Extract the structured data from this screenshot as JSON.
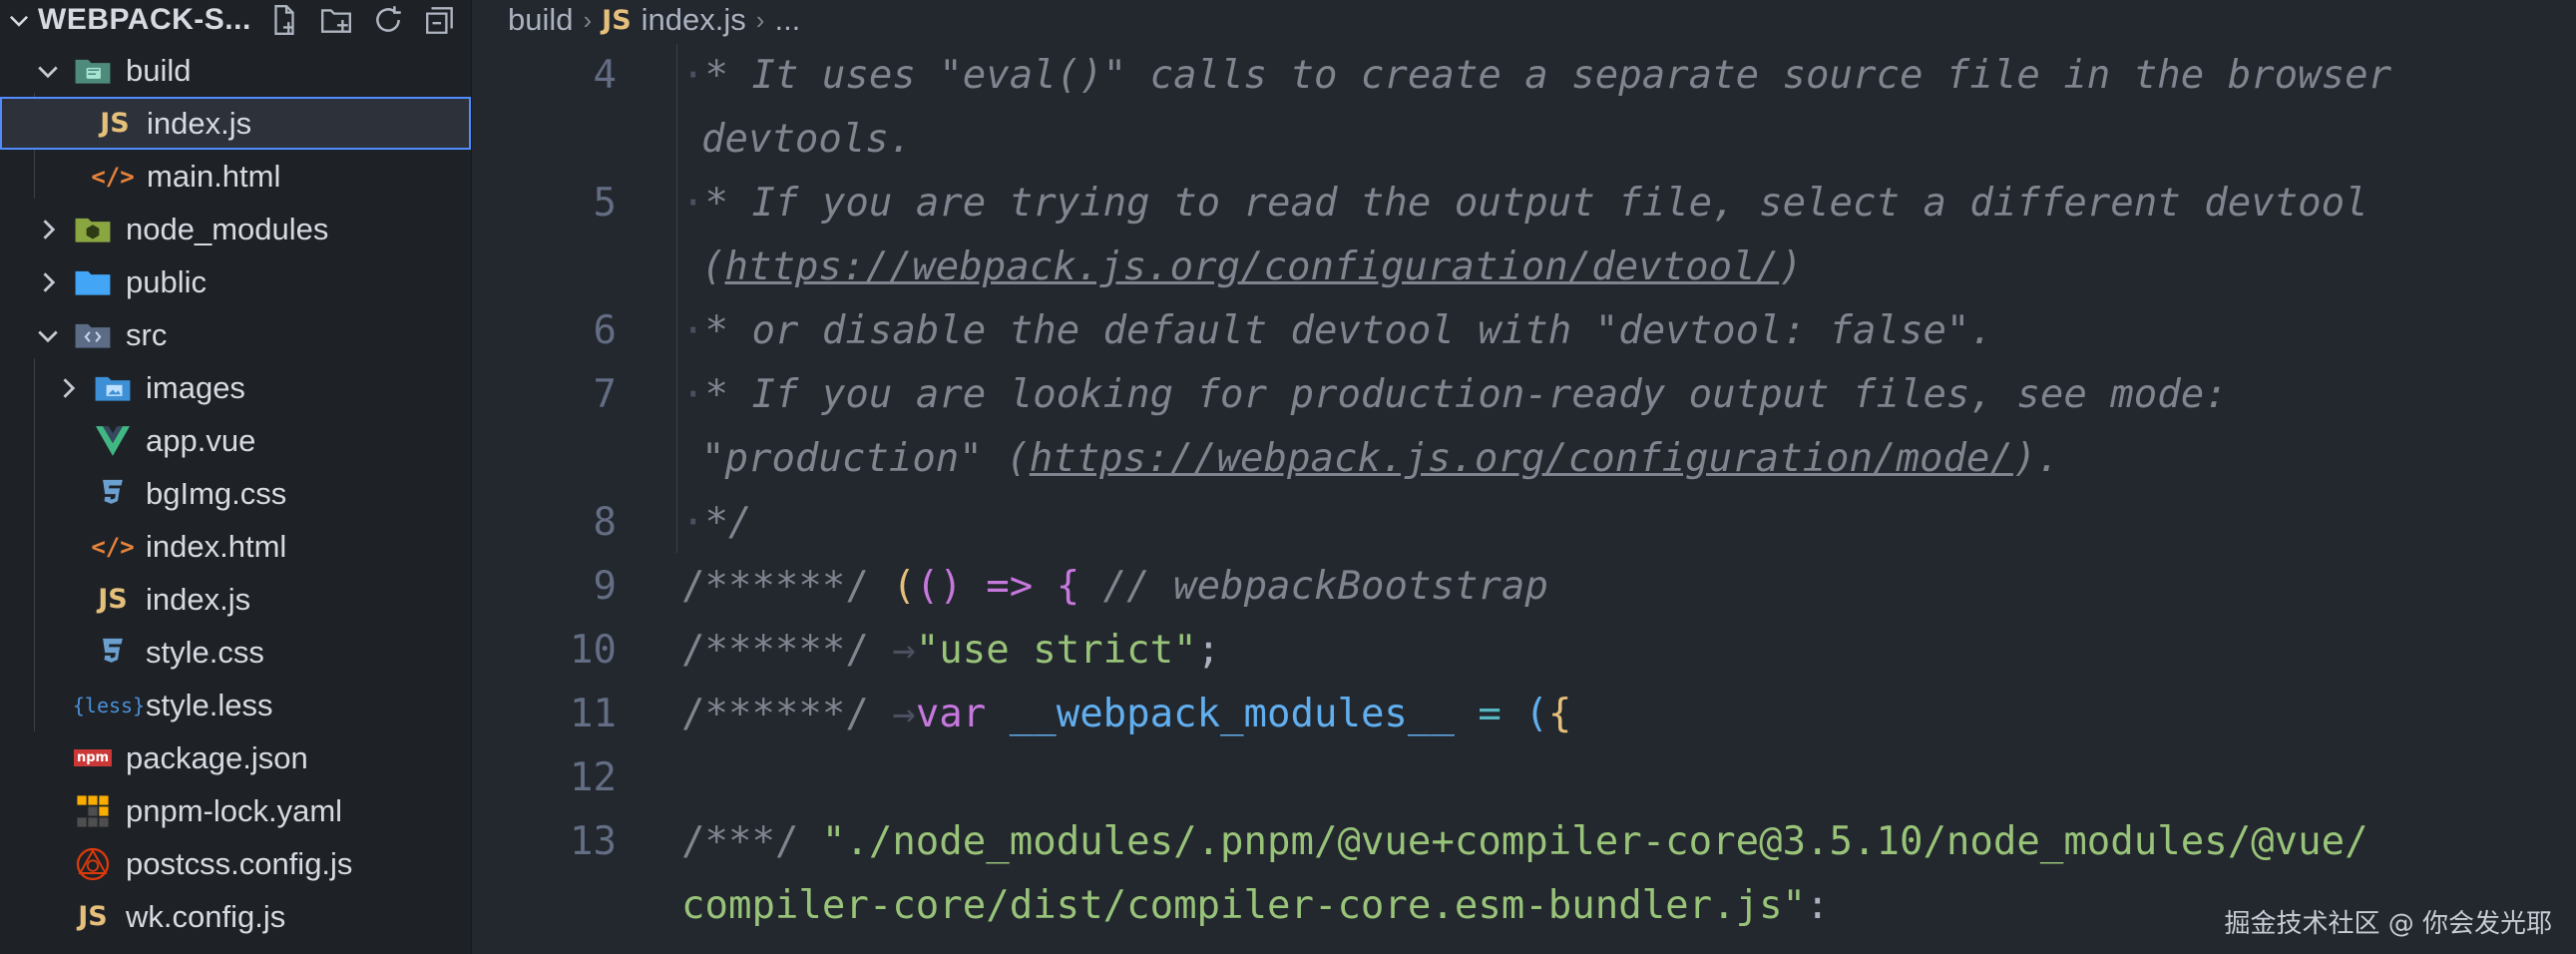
{
  "explorer": {
    "title": "WEBPACK-S...",
    "items": [
      {
        "label": "build",
        "kind": "folder-open"
      },
      {
        "label": "index.js",
        "kind": "js"
      },
      {
        "label": "main.html",
        "kind": "html"
      },
      {
        "label": "node_modules",
        "kind": "folder"
      },
      {
        "label": "public",
        "kind": "folder"
      },
      {
        "label": "src",
        "kind": "folder-open"
      },
      {
        "label": "images",
        "kind": "folder"
      },
      {
        "label": "app.vue",
        "kind": "vue"
      },
      {
        "label": "bgImg.css",
        "kind": "css"
      },
      {
        "label": "index.html",
        "kind": "html"
      },
      {
        "label": "index.js",
        "kind": "js"
      },
      {
        "label": "style.css",
        "kind": "css"
      },
      {
        "label": "style.less",
        "kind": "less"
      },
      {
        "label": "package.json",
        "kind": "npm"
      },
      {
        "label": "pnpm-lock.yaml",
        "kind": "pnpm"
      },
      {
        "label": "postcss.config.js",
        "kind": "postcss"
      },
      {
        "label": "wk.config.js",
        "kind": "js"
      }
    ],
    "icon_text": {
      "js": "JS",
      "html": "</>",
      "less": "{less}",
      "npm": "npm"
    }
  },
  "breadcrumb": {
    "folder": "build",
    "file_icon": "JS",
    "file": "index.js",
    "more": "..."
  },
  "code": {
    "line_numbers": [
      "4",
      "5",
      "6",
      "7",
      "8",
      "9",
      "10",
      "11",
      "12",
      "13"
    ],
    "l4a": "It uses \"eval()\" calls to create a separate source file in the browser",
    "l4b": "devtools.",
    "l5a": "If you are trying to read the output file, select a different devtool",
    "l5b_open": "(",
    "l5b_url": "https://webpack.js.org/configuration/devtool/",
    "l5b_close": ")",
    "l6": "or disable the default devtool with \"devtool: false\".",
    "l7a": "If you are looking for production-ready output files, see mode:",
    "l7b_pre": "\"production\" (",
    "l7b_url": "https://webpack.js.org/configuration/mode/",
    "l7b_post": ").",
    "l8": "*/",
    "l9_comment": "/******/",
    "l9_comment2": "// webpackBootstrap",
    "l10_str": "\"use strict\"",
    "l11_kw": "var",
    "l11_var": "__webpack_modules__",
    "l13_comment": "/***/",
    "l13_str_a": "\"./node_modules/.pnpm/@vue+compiler-core@3.5.10/node_modules/@vue/",
    "l13_str_b": "compiler-core/dist/compiler-core.esm-bundler.js\""
  },
  "watermark": "掘金技术社区 @ 你会发光耶",
  "colors": {
    "accent": "#528bff",
    "string": "#98c379",
    "keyword": "#c678dd",
    "comment": "#7f848e"
  }
}
